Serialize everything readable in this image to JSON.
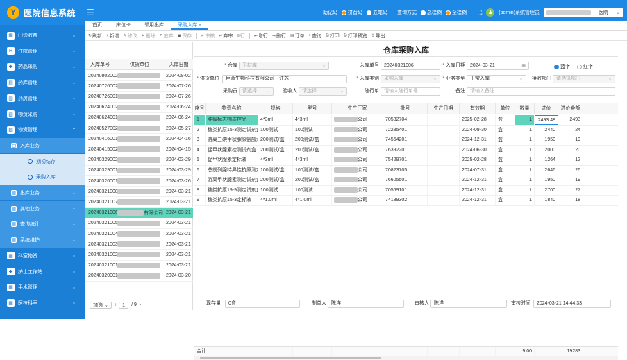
{
  "app": {
    "title": "医院信息系统",
    "logo_text": "Y"
  },
  "topbar": {
    "input_mode_label": "助记码",
    "input_modes": [
      {
        "label": "拼音码",
        "selected": true
      },
      {
        "label": "五笔码",
        "selected": false
      }
    ],
    "query_mode_label": "查询方式",
    "query_modes": [
      {
        "label": "总模糊",
        "selected": false
      },
      {
        "label": "全模糊",
        "selected": true
      }
    ],
    "user": "(admin)系统管理员",
    "hospital_suffix": "医院"
  },
  "sidebar": {
    "items": [
      {
        "label": "门诊收费",
        "level": 0,
        "chevron": "⌄"
      },
      {
        "label": "住院管理",
        "level": 0,
        "chevron": "⌄"
      },
      {
        "label": "药品采购",
        "level": 0,
        "chevron": "⌄"
      },
      {
        "label": "药库管理",
        "level": 0,
        "chevron": "⌄"
      },
      {
        "label": "药房管理",
        "level": 0,
        "chevron": "⌄"
      },
      {
        "label": "物资采购",
        "level": 0,
        "chevron": "⌄"
      },
      {
        "label": "物资管理",
        "level": 0,
        "chevron": "⌃"
      },
      {
        "label": "入库业务",
        "level": 1,
        "chevron": "⌃"
      },
      {
        "label": "期初结存",
        "level": 2,
        "chevron": ""
      },
      {
        "label": "采购入库",
        "level": 2,
        "chevron": ""
      },
      {
        "label": "出库业务",
        "level": 1,
        "chevron": "⌄"
      },
      {
        "label": "其他业务",
        "level": 1,
        "chevron": "⌄"
      },
      {
        "label": "查询统计",
        "level": 1,
        "chevron": "⌄"
      },
      {
        "label": "系统维护",
        "level": 1,
        "chevron": "⌄"
      },
      {
        "label": "科室物资",
        "level": 0,
        "chevron": "⌄"
      },
      {
        "label": "护士工作站",
        "level": 0,
        "chevron": "⌄"
      },
      {
        "label": "手术管理",
        "level": 0,
        "chevron": "⌄"
      },
      {
        "label": "医技科室",
        "level": 0,
        "chevron": "⌄"
      }
    ]
  },
  "tabs": [
    {
      "label": "首页"
    },
    {
      "label": "床位卡"
    },
    {
      "label": "领用出库"
    },
    {
      "label": "采购入库",
      "active": true
    }
  ],
  "toolbar": [
    {
      "icon": "↻",
      "label": "刷新"
    },
    {
      "icon": "+",
      "label": "新增"
    },
    {
      "icon": "✎",
      "label": "修改",
      "disabled": true
    },
    {
      "icon": "✕",
      "label": "删除",
      "disabled": true
    },
    {
      "icon": "↶",
      "label": "放弃",
      "disabled": true
    },
    {
      "icon": "▣",
      "label": "保存",
      "disabled": true
    },
    {
      "icon": "✓",
      "label": "审核",
      "disabled": true
    },
    {
      "icon": "↩",
      "label": "弃审"
    },
    {
      "icon": "≡",
      "label": "行",
      "disabled": true
    },
    {
      "icon": "⇤",
      "label": "增行"
    },
    {
      "icon": "⇥",
      "label": "删行"
    },
    {
      "icon": "▤",
      "label": "订单"
    },
    {
      "icon": "⌕",
      "label": "查询"
    },
    {
      "icon": "⎙",
      "label": "打印"
    },
    {
      "icon": "⎙",
      "label": "打印预览"
    },
    {
      "icon": "⇪",
      "label": "导出"
    }
  ],
  "left_list": {
    "headers": [
      "入库单号",
      "供货单位",
      "入库日期"
    ],
    "rows": [
      {
        "no": "20240802002",
        "date": "2024-08-02"
      },
      {
        "no": "20240726002",
        "date": "2024-07-26"
      },
      {
        "no": "20240726001",
        "date": "2024-07-26"
      },
      {
        "no": "20240624002",
        "date": "2024-06-24"
      },
      {
        "no": "20240624001",
        "date": "2024-06-24"
      },
      {
        "no": "20240527002",
        "date": "2024-05-27"
      },
      {
        "no": "20240416001",
        "date": "2024-04-16"
      },
      {
        "no": "20240415002",
        "date": "2024-04-15"
      },
      {
        "no": "20240329002",
        "date": "2024-03-29"
      },
      {
        "no": "20240329001",
        "date": "2024-03-29"
      },
      {
        "no": "20240326001",
        "date": "2024-03-26"
      },
      {
        "no": "20240321008",
        "date": "2024-03-21"
      },
      {
        "no": "20240321007",
        "date": "2024-03-21"
      },
      {
        "no": "20240321006",
        "date": "2024-03-21",
        "selected": true,
        "supplier_visible": "有限公司..."
      },
      {
        "no": "20240321005",
        "date": "2024-03-21"
      },
      {
        "no": "20240321004",
        "date": "2024-03-21"
      },
      {
        "no": "20240321003",
        "date": "2024-03-21"
      },
      {
        "no": "20240321002",
        "date": "2024-03-21"
      },
      {
        "no": "20240321001",
        "date": "2024-03-21"
      },
      {
        "no": "20240320001",
        "date": "2024-03-20"
      }
    ],
    "pager": {
      "mode": "加选",
      "current": "1",
      "total": "/ 9"
    }
  },
  "form": {
    "title": "仓库采购入库",
    "warehouse_label": "仓库",
    "warehouse_value": "卫材库",
    "receipt_no_label": "入库单号",
    "receipt_no_value": "20240321006",
    "date_label": "入库日期",
    "date_value": "2024-03-21",
    "color_options": [
      {
        "label": "蓝字",
        "selected": true
      },
      {
        "label": "红字",
        "selected": false
      }
    ],
    "supplier_label": "供货单位",
    "supplier_value": "巨蓝生物科技有限公司（江苏）",
    "type_label": "入库类别",
    "type_value": "采购入库",
    "biz_label": "业务类型",
    "biz_value": "正常入库",
    "dept_label": "接收部门",
    "dept_placeholder": "请选择部门",
    "buyer_label": "采购员",
    "buyer_placeholder": "请选择",
    "checker_label": "验收人",
    "checker_placeholder": "请选择",
    "follow_label": "随行单",
    "follow_placeholder": "请输入随行单号",
    "note_label": "备注",
    "note_placeholder": "请输入备注"
  },
  "grid": {
    "headers": [
      "序号",
      "物资名称",
      "规格",
      "型号",
      "生产厂家",
      "批号",
      "生产日期",
      "有效期",
      "单位",
      "数量",
      "进价",
      "进价金额"
    ],
    "rows": [
      {
        "seq": "1",
        "name": "肿瘤标志物质控品",
        "spec": "4*3ml",
        "model": "4*3ml",
        "maker": "公司",
        "batch": "70582704",
        "mfg": "",
        "exp": "2025-02-28",
        "unit": "盒",
        "qty": "1",
        "price": "2493.48",
        "amount": "2493"
      },
      {
        "seq": "2",
        "name": "糖类抗原15-3测定试剂盒",
        "spec": "100测试",
        "model": "100测试",
        "maker": "公司",
        "batch": "72285401",
        "mfg": "",
        "exp": "2024-09-30",
        "unit": "盒",
        "qty": "1",
        "price": "2440",
        "amount": "24"
      },
      {
        "seq": "3",
        "name": "游离三碘甲状腺原氨酸测试...",
        "spec": "200测试/盒",
        "model": "200测试/盒",
        "maker": "公司",
        "batch": "74564201",
        "mfg": "",
        "exp": "2024-12-31",
        "unit": "盒",
        "qty": "1",
        "price": "1950",
        "amount": "19"
      },
      {
        "seq": "4",
        "name": "促甲状腺素检测试剂盒",
        "spec": "200测试/盒",
        "model": "200测试/盒",
        "maker": "公司",
        "batch": "76392201",
        "mfg": "",
        "exp": "2024-06-30",
        "unit": "盒",
        "qty": "1",
        "price": "2000",
        "amount": "20"
      },
      {
        "seq": "5",
        "name": "促甲状腺素定标液",
        "spec": "4*3ml",
        "model": "4*3ml",
        "maker": "公司",
        "batch": "75429701",
        "mfg": "",
        "exp": "2025-02-28",
        "unit": "盒",
        "qty": "1",
        "price": "1264",
        "amount": "12"
      },
      {
        "seq": "6",
        "name": "总前列腺特异性抗原测定试剂...",
        "spec": "100测试/盒",
        "model": "100测试/盒",
        "maker": "公司",
        "batch": "70823705",
        "mfg": "",
        "exp": "2024-07-31",
        "unit": "盒",
        "qty": "1",
        "price": "2646",
        "amount": "26"
      },
      {
        "seq": "7",
        "name": "游离甲状腺素测定试剂盒",
        "spec": "200测试/盒",
        "model": "200测试/盒",
        "maker": "公司",
        "batch": "76605501",
        "mfg": "",
        "exp": "2024-12-31",
        "unit": "盒",
        "qty": "1",
        "price": "1950",
        "amount": "19"
      },
      {
        "seq": "8",
        "name": "糖类抗原19-9测定试剂盒",
        "spec": "100测试",
        "model": "100测试",
        "maker": "公司",
        "batch": "70569101",
        "mfg": "",
        "exp": "2024-12-31",
        "unit": "盒",
        "qty": "1",
        "price": "2700",
        "amount": "27"
      },
      {
        "seq": "9",
        "name": "糖类抗原15-3定标液",
        "spec": "4*1.0ml",
        "model": "4*1.0ml",
        "maker": "公司",
        "batch": "74189302",
        "mfg": "",
        "exp": "2024-12-31",
        "unit": "盒",
        "qty": "1",
        "price": "1840",
        "amount": "18"
      }
    ],
    "footer": {
      "label": "合计",
      "qty": "9.00",
      "amount": "19283"
    }
  },
  "bottom": {
    "stock_label": "现存量",
    "stock_value": "0盒",
    "maker_label": "制单人",
    "maker_value": "陈洋",
    "auditor_label": "审核人",
    "auditor_value": "陈洋",
    "audit_time_label": "审核时间",
    "audit_time_value": "2024-03-21 14:44:33"
  }
}
